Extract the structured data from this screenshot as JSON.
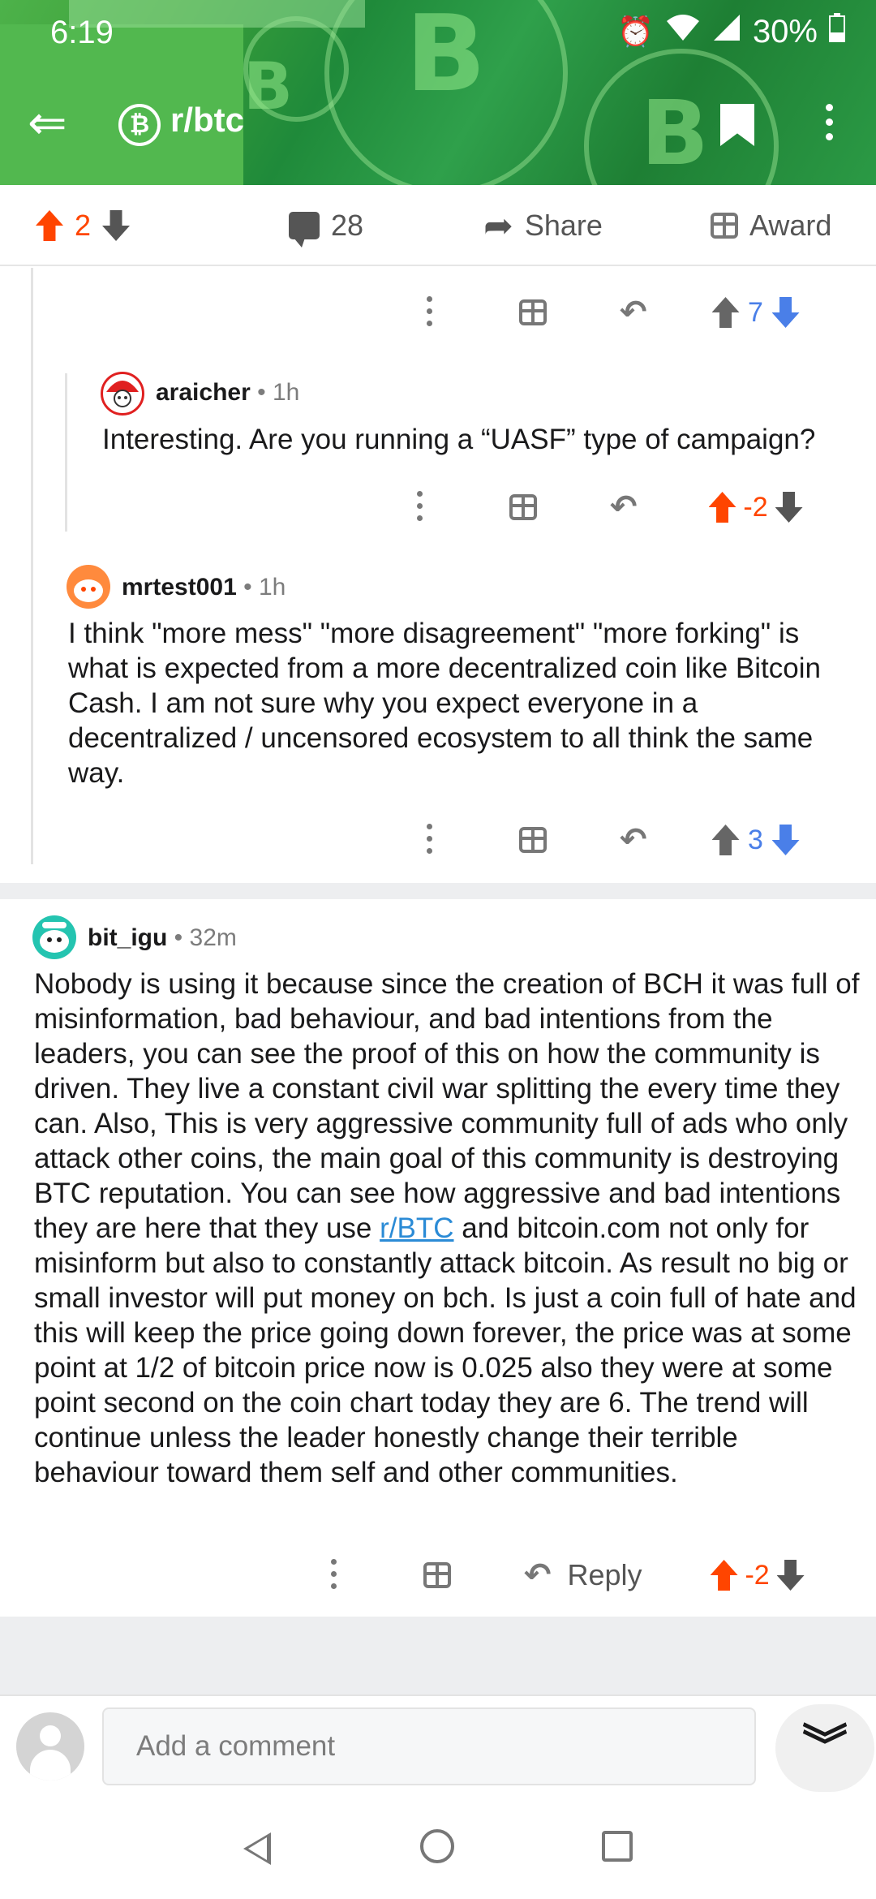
{
  "status_bar": {
    "time": "6:19",
    "battery": "30%",
    "icons": [
      "alarm-icon",
      "wifi-icon",
      "signal-icon",
      "battery-icon"
    ]
  },
  "header": {
    "subreddit": "r/btc",
    "logo_glyph": "₿",
    "back_glyph": "⇐"
  },
  "post_actions": {
    "score": "2",
    "comments": "28",
    "share": "Share",
    "award": "Award"
  },
  "comments": [
    {
      "id": "c0",
      "score": "7"
    },
    {
      "id": "c1",
      "username": "araicher",
      "age": "1h",
      "body": "Interesting. Are you running a “UASF” type of campaign?",
      "score": "-2"
    },
    {
      "id": "c2",
      "username": "mrtest001",
      "age": "1h",
      "body": "I think \"more mess\" \"more disagreement\" \"more forking\" is what is expected from a more decentralized coin like Bitcoin Cash.  I am not sure why you expect everyone in a decentralized / uncensored ecosystem to all think the same way.",
      "score": "3"
    },
    {
      "id": "c3",
      "username": "bit_igu",
      "age": "32m",
      "body_before": "Nobody is using it because since the creation of BCH it was full of misinformation, bad behaviour, and bad intentions from the leaders, you can see the proof of this on how the community is driven. They live a constant civil war splitting the every time they can. Also, This is very aggressive community full of ads who only attack other coins, the main goal of this community is destroying BTC reputation. You can see how aggressive and bad intentions they are here that they use ",
      "link": "r/BTC",
      "body_after": " and bitcoin.com not only for misinform but also to constantly attack bitcoin. As result no big or small investor will put money on bch. Is just a coin full of hate and this will keep the price going down forever, the price was at some point at 1/2 of bitcoin price now is 0.025 also they were at some point second on the coin chart today they are 6. The trend will continue unless the leader honestly change their terrible behaviour toward them self and other communities.",
      "reply": "Reply",
      "score": "-2"
    }
  ],
  "composer": {
    "placeholder": "Add a comment"
  },
  "colors": {
    "upvote": "#ff4500",
    "downvote": "#4a7fe8",
    "header_green": "#3ea23b",
    "link": "#2b8bd6"
  }
}
